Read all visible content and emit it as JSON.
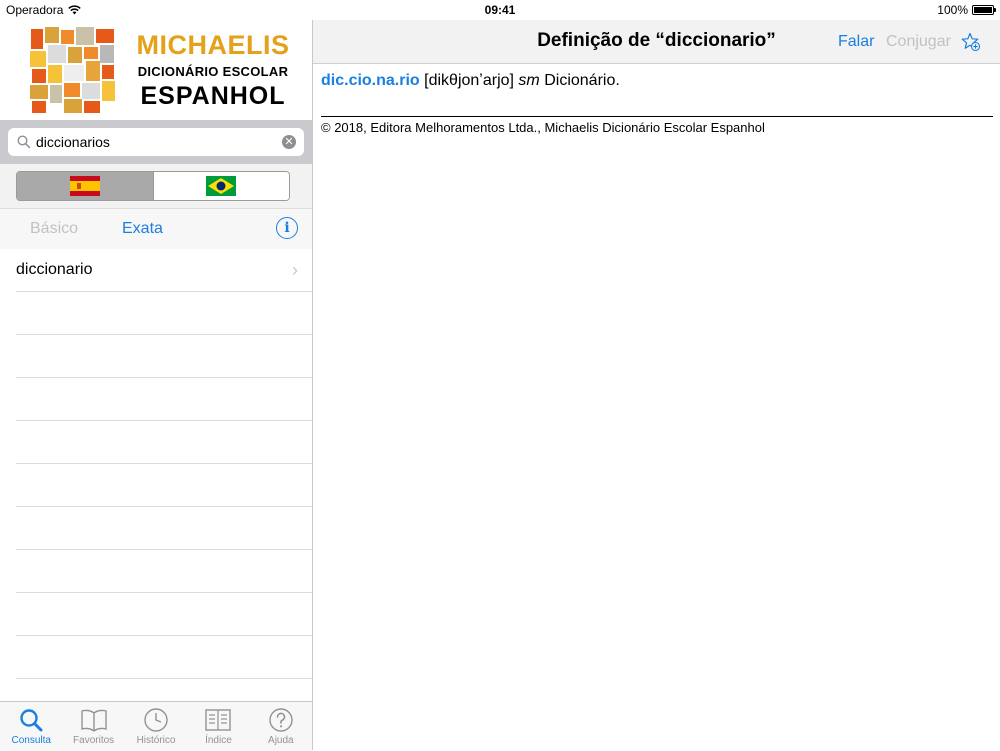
{
  "status": {
    "carrier": "Operadora",
    "time": "09:41",
    "battery": "100%"
  },
  "logo": {
    "line1": "MICHAELIS",
    "line2": "DICIONÁRIO ESCOLAR",
    "line3": "ESPANHOL"
  },
  "search": {
    "value": "diccionarios"
  },
  "modes": {
    "basic": "Básico",
    "exact": "Exata"
  },
  "results": [
    {
      "label": "diccionario"
    }
  ],
  "tabs": [
    {
      "label": "Consulta",
      "icon": "search-icon"
    },
    {
      "label": "Favoritos",
      "icon": "book-icon"
    },
    {
      "label": "Histórico",
      "icon": "clock-icon"
    },
    {
      "label": "Índice",
      "icon": "index-icon"
    },
    {
      "label": "Ajuda",
      "icon": "help-icon"
    }
  ],
  "detail": {
    "title": "Definição de “diccionario”",
    "speak": "Falar",
    "conjugate": "Conjugar",
    "headword": "dic.cio.na.rio",
    "pronunciation": "[dikθjonʼarjo]",
    "pos": "sm",
    "definition": "Dicionário.",
    "copyright": "© 2018, Editora Melhoramentos Ltda., Michaelis Dicionário Escolar Espanhol"
  },
  "colors": {
    "accent": "#1a7fe0",
    "brand": "#e3a21a"
  }
}
